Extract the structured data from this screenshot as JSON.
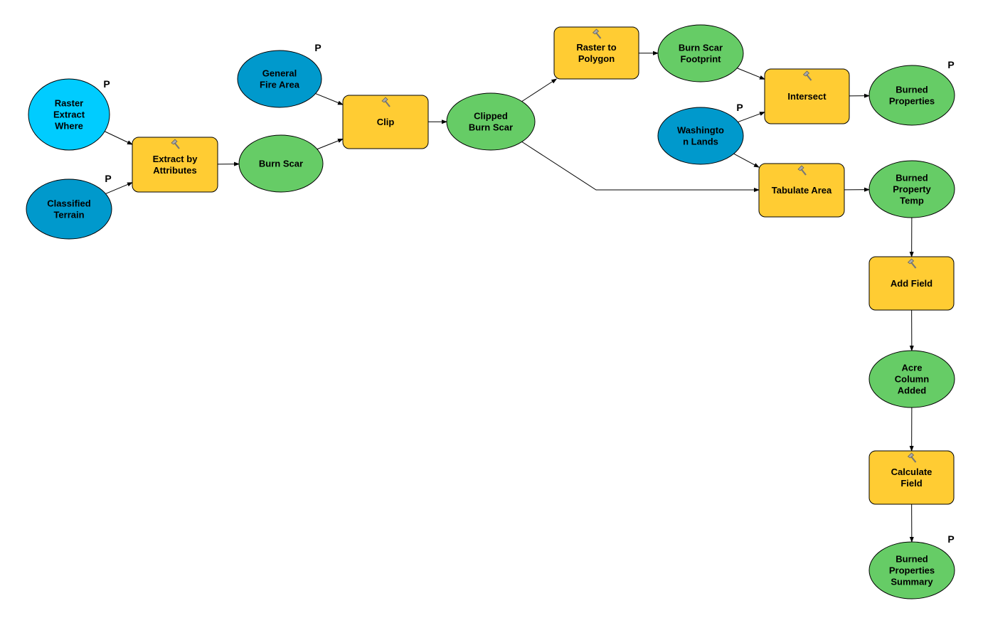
{
  "colors": {
    "tool": "#FFCC33",
    "derived": "#66CC66",
    "input": "#0099CC",
    "variable": "#00CCFF",
    "stroke": "#000000"
  },
  "nodes": [
    {
      "id": "rew",
      "kind": "variable",
      "lines": [
        "Raster",
        "Extract",
        "Where"
      ],
      "param": "P"
    },
    {
      "id": "ct",
      "kind": "input",
      "lines": [
        "Classified",
        "Terrain"
      ],
      "param": "P"
    },
    {
      "id": "eba",
      "kind": "tool",
      "icon": "hammer-icon",
      "lines": [
        "Extract by",
        "Attributes"
      ]
    },
    {
      "id": "bs",
      "kind": "derived",
      "lines": [
        "Burn Scar"
      ]
    },
    {
      "id": "gfa",
      "kind": "input",
      "lines": [
        "General",
        "Fire Area"
      ],
      "param": "P"
    },
    {
      "id": "clip",
      "kind": "tool",
      "icon": "hammer-icon",
      "lines": [
        "Clip"
      ]
    },
    {
      "id": "cbs",
      "kind": "derived",
      "lines": [
        "Clipped",
        "Burn Scar"
      ]
    },
    {
      "id": "rtp",
      "kind": "tool",
      "icon": "hammer-icon",
      "lines": [
        "Raster to",
        "Polygon"
      ]
    },
    {
      "id": "bsf",
      "kind": "derived",
      "lines": [
        "Burn Scar",
        "Footprint"
      ]
    },
    {
      "id": "wl",
      "kind": "input",
      "lines": [
        "Washingto",
        "n Lands"
      ],
      "param": "P"
    },
    {
      "id": "int",
      "kind": "tool",
      "icon": "hammer-icon",
      "lines": [
        "Intersect"
      ]
    },
    {
      "id": "bp",
      "kind": "derived",
      "lines": [
        "Burned",
        "Properties"
      ],
      "param": "P"
    },
    {
      "id": "ta",
      "kind": "tool",
      "icon": "hammer-icon",
      "lines": [
        "Tabulate Area"
      ]
    },
    {
      "id": "bpt",
      "kind": "derived",
      "lines": [
        "Burned",
        "Property",
        "Temp"
      ]
    },
    {
      "id": "af",
      "kind": "tool",
      "icon": "hammer-icon",
      "lines": [
        "Add Field"
      ]
    },
    {
      "id": "aca",
      "kind": "derived",
      "lines": [
        "Acre",
        "Column",
        "Added"
      ]
    },
    {
      "id": "cf",
      "kind": "tool",
      "icon": "hammer-icon",
      "lines": [
        "Calculate",
        "Field"
      ]
    },
    {
      "id": "bps",
      "kind": "derived",
      "lines": [
        "Burned",
        "Properties",
        "Summary"
      ],
      "param": "P"
    }
  ],
  "edges": [
    [
      "rew",
      "eba"
    ],
    [
      "ct",
      "eba"
    ],
    [
      "eba",
      "bs"
    ],
    [
      "gfa",
      "clip"
    ],
    [
      "bs",
      "clip"
    ],
    [
      "clip",
      "cbs"
    ],
    [
      "cbs",
      "rtp"
    ],
    [
      "rtp",
      "bsf"
    ],
    [
      "bsf",
      "int"
    ],
    [
      "wl",
      "int"
    ],
    [
      "int",
      "bp"
    ],
    [
      "wl",
      "ta"
    ],
    [
      "cbs",
      "ta"
    ],
    [
      "ta",
      "bpt"
    ],
    [
      "bpt",
      "af"
    ],
    [
      "af",
      "aca"
    ],
    [
      "aca",
      "cf"
    ],
    [
      "cf",
      "bps"
    ]
  ]
}
